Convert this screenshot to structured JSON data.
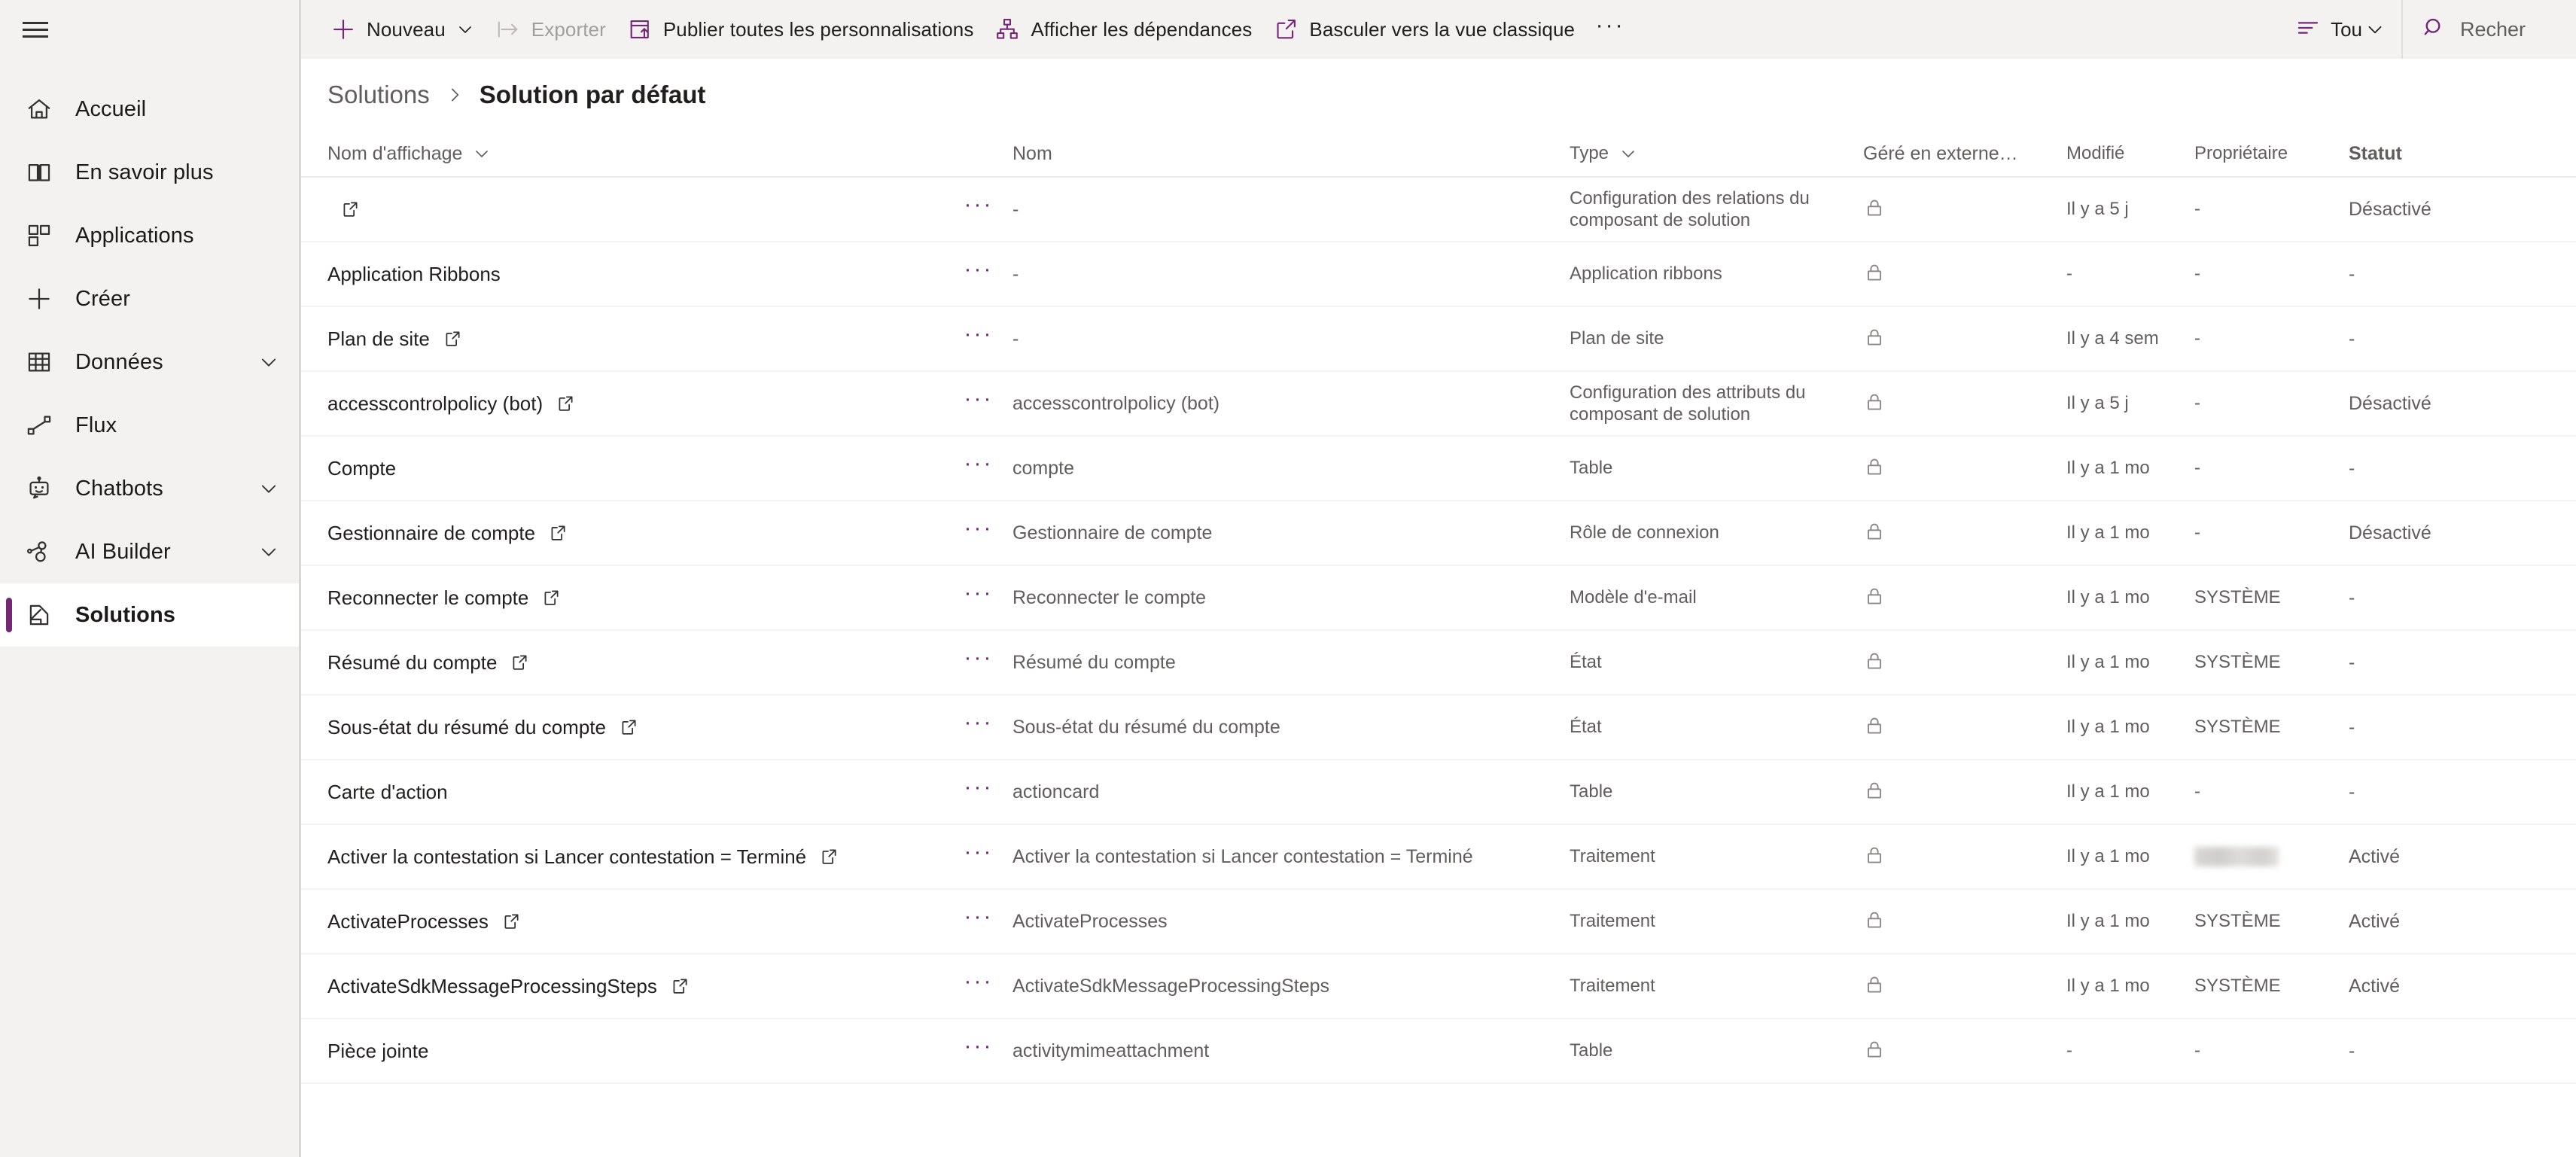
{
  "sidebar": {
    "menu_icon": "hamburger-icon",
    "items": [
      {
        "label": "Accueil",
        "icon": "home-icon",
        "expandable": false,
        "selected": false
      },
      {
        "label": "En savoir plus",
        "icon": "book-icon",
        "expandable": false,
        "selected": false
      },
      {
        "label": "Applications",
        "icon": "apps-grid-icon",
        "expandable": false,
        "selected": false
      },
      {
        "label": "Créer",
        "icon": "plus-icon",
        "expandable": false,
        "selected": false
      },
      {
        "label": "Données",
        "icon": "table-icon",
        "expandable": true,
        "selected": false
      },
      {
        "label": "Flux",
        "icon": "flow-icon",
        "expandable": false,
        "selected": false
      },
      {
        "label": "Chatbots",
        "icon": "robot-icon",
        "expandable": true,
        "selected": false
      },
      {
        "label": "AI Builder",
        "icon": "ai-builder-icon",
        "expandable": true,
        "selected": false
      },
      {
        "label": "Solutions",
        "icon": "solutions-icon",
        "expandable": false,
        "selected": true
      }
    ]
  },
  "commandbar": {
    "buttons": [
      {
        "label": "Nouveau",
        "icon": "plus-icon",
        "has_chevron": true,
        "disabled": false
      },
      {
        "label": "Exporter",
        "icon": "export-icon",
        "has_chevron": false,
        "disabled": true
      },
      {
        "label": "Publier toutes les personnalisations",
        "icon": "publish-icon",
        "has_chevron": false,
        "disabled": false
      },
      {
        "label": "Afficher les dépendances",
        "icon": "dependencies-icon",
        "has_chevron": false,
        "disabled": false
      },
      {
        "label": "Basculer vers la vue classique",
        "icon": "open-in-new-icon",
        "has_chevron": false,
        "disabled": false
      }
    ],
    "overflow_label": "···",
    "filter": {
      "label": "Tou",
      "icon": "filter-icon"
    },
    "search": {
      "placeholder": "Recher",
      "icon": "search-icon"
    }
  },
  "breadcrumb": {
    "parent": "Solutions",
    "separator": "›",
    "current": "Solution par défaut"
  },
  "table": {
    "columns": [
      {
        "key": "display_name",
        "label": "Nom d'affichage",
        "sortable": true,
        "strong": false
      },
      {
        "key": "name",
        "label": "Nom",
        "sortable": false,
        "strong": false
      },
      {
        "key": "type",
        "label": "Type",
        "sortable": true,
        "strong": false
      },
      {
        "key": "managed",
        "label": "Géré en externe…",
        "sortable": false,
        "strong": false
      },
      {
        "key": "modified",
        "label": "Modifié",
        "sortable": false,
        "strong": false
      },
      {
        "key": "owner",
        "label": "Propriétaire",
        "sortable": false,
        "strong": false
      },
      {
        "key": "status",
        "label": "Statut",
        "sortable": false,
        "strong": true
      }
    ],
    "rows": [
      {
        "display_name": "",
        "has_external_link": true,
        "name": "-",
        "type": "Configuration des relations du composant de solution",
        "managed": "lock-icon",
        "modified": "Il y a 5 j",
        "owner": "-",
        "status": "Désactivé",
        "owner_redacted": false
      },
      {
        "display_name": "Application Ribbons",
        "has_external_link": false,
        "name": "-",
        "type": "Application ribbons",
        "managed": "lock-icon",
        "modified": "-",
        "owner": "-",
        "status": "-",
        "owner_redacted": false
      },
      {
        "display_name": "Plan de site",
        "has_external_link": true,
        "name": "-",
        "type": "Plan de site",
        "managed": "lock-icon",
        "modified": "Il y a 4 sem",
        "owner": "-",
        "status": "-",
        "owner_redacted": false
      },
      {
        "display_name": "accesscontrolpolicy (bot)",
        "has_external_link": true,
        "name": "accesscontrolpolicy (bot)",
        "type": "Configuration des attributs du composant de solution",
        "managed": "lock-icon",
        "modified": "Il y a 5 j",
        "owner": "-",
        "status": "Désactivé",
        "owner_redacted": false
      },
      {
        "display_name": "Compte",
        "has_external_link": false,
        "name": "compte",
        "type": "Table",
        "managed": "lock-icon",
        "modified": "Il y a 1 mo",
        "owner": "-",
        "status": "-",
        "owner_redacted": false
      },
      {
        "display_name": "Gestionnaire de compte",
        "has_external_link": true,
        "name": "Gestionnaire de compte",
        "type": "Rôle de connexion",
        "managed": "lock-icon",
        "modified": "Il y a 1 mo",
        "owner": "-",
        "status": "Désactivé",
        "owner_redacted": false
      },
      {
        "display_name": "Reconnecter le compte",
        "has_external_link": true,
        "name": "Reconnecter le compte",
        "type": "Modèle d'e-mail",
        "managed": "lock-icon",
        "modified": "Il y a 1 mo",
        "owner": "SYSTÈME",
        "status": "-",
        "owner_redacted": false
      },
      {
        "display_name": "Résumé du compte",
        "has_external_link": true,
        "name": "Résumé du compte",
        "type": "État",
        "managed": "lock-icon",
        "modified": "Il y a 1 mo",
        "owner": "SYSTÈME",
        "status": "-",
        "owner_redacted": false
      },
      {
        "display_name": "Sous-état du résumé du compte",
        "has_external_link": true,
        "name": "Sous-état du résumé du compte",
        "type": "État",
        "managed": "lock-icon",
        "modified": "Il y a 1 mo",
        "owner": "SYSTÈME",
        "status": "-",
        "owner_redacted": false
      },
      {
        "display_name": "Carte d'action",
        "has_external_link": false,
        "name": "actioncard",
        "type": "Table",
        "managed": "lock-icon",
        "modified": "Il y a 1 mo",
        "owner": "-",
        "status": "-",
        "owner_redacted": false
      },
      {
        "display_name": "Activer la contestation si Lancer contestation = Terminé",
        "has_external_link": true,
        "name": "Activer la contestation si Lancer contestation = Terminé",
        "type": "Traitement",
        "managed": "lock-icon",
        "modified": "Il y a 1 mo",
        "owner": "",
        "status": "Activé",
        "owner_redacted": true
      },
      {
        "display_name": "ActivateProcesses",
        "has_external_link": true,
        "name": "ActivateProcesses",
        "type": "Traitement",
        "managed": "lock-icon",
        "modified": "Il y a 1 mo",
        "owner": "SYSTÈME",
        "status": "Activé",
        "owner_redacted": false
      },
      {
        "display_name": "ActivateSdkMessageProcessingSteps",
        "has_external_link": true,
        "name": "ActivateSdkMessageProcessingSteps",
        "type": "Traitement",
        "managed": "lock-icon",
        "modified": "Il y a 1 mo",
        "owner": "SYSTÈME",
        "status": "Activé",
        "owner_redacted": false
      },
      {
        "display_name": "Pièce jointe",
        "has_external_link": false,
        "name": "activitymimeattachment",
        "type": "Table",
        "managed": "lock-icon",
        "modified": "-",
        "owner": "-",
        "status": "-",
        "owner_redacted": false
      }
    ]
  },
  "colors": {
    "accent": "#742774",
    "sidebar_bg": "#f3f2f1",
    "commandbar_bg": "#f3f2f1",
    "text_primary": "#201f1e",
    "text_secondary": "#605e5c"
  }
}
